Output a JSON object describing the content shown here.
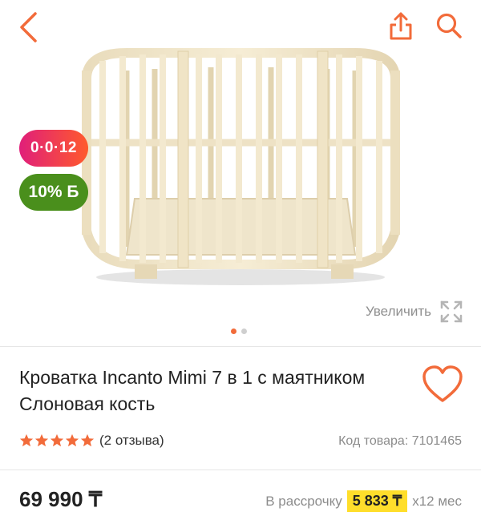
{
  "header": {
    "back_icon": "chevron-left-icon",
    "share_icon": "share-icon",
    "search_icon": "search-icon",
    "accent_color": "#f26b3a"
  },
  "gallery": {
    "badges": {
      "installment": "0·0·12",
      "bonus": "10% Б"
    },
    "zoom_label": "Увеличить",
    "page_count": 2,
    "active_page": 1
  },
  "product": {
    "title": "Кроватка Incanto Mimi 7 в 1 с маятником Слоновая кость",
    "rating": 5,
    "reviews": "(2 отзыва)",
    "sku": "Код товара: 7101465",
    "price": "69 990 ₸",
    "installment_label": "В рассрочку",
    "installment_amount": "5 833 ₸",
    "installment_term": "х12 мес"
  }
}
